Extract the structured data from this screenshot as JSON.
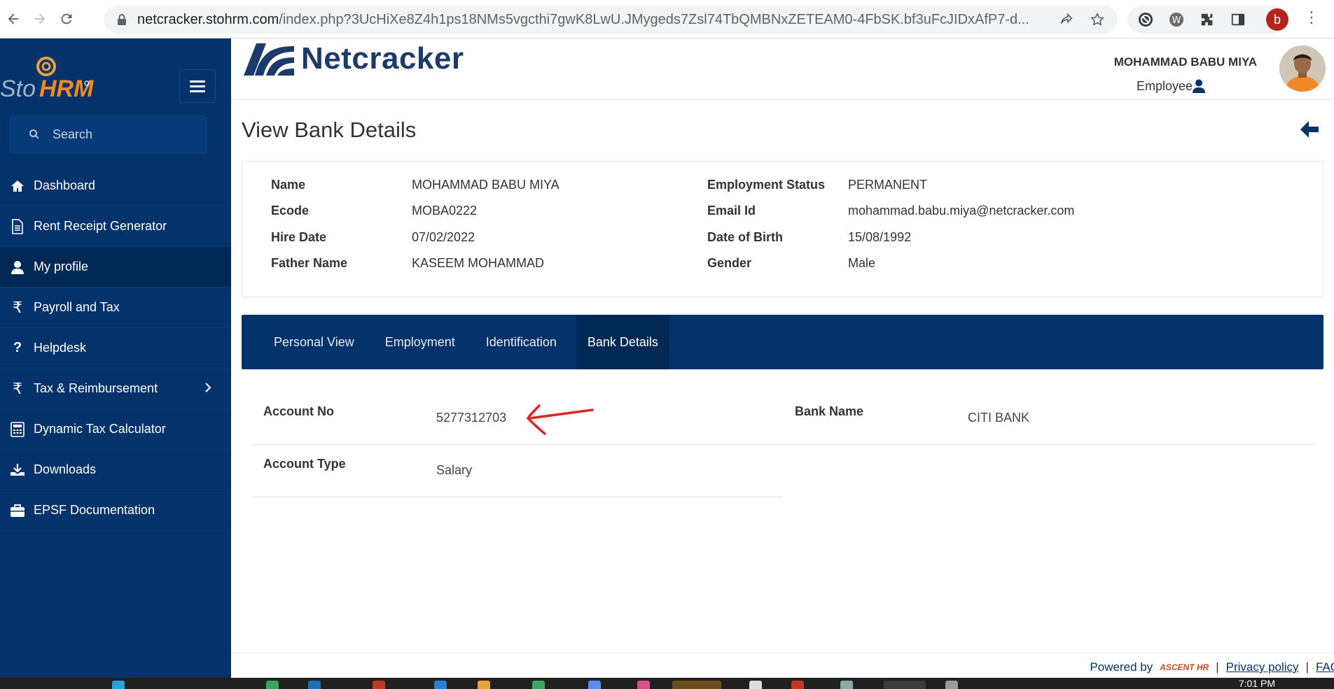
{
  "browser": {
    "url_host": "netcracker.stohrm.com",
    "url_path": "/index.php?3UcHiXe8Z4h1ps18NMs5vgcthi7gwK8LwU.JMygeds7Zsl74TbQMBNxZETEAM0-4FbSK.bf3uFcJIDxAfP7-d...",
    "profile_initial": "b"
  },
  "sidebar": {
    "logo_text": "StoHRM",
    "search_placeholder": "Search",
    "items": [
      {
        "label": "Dashboard",
        "icon": "home-icon"
      },
      {
        "label": "Rent Receipt Generator",
        "icon": "document-icon"
      },
      {
        "label": "My profile",
        "icon": "user-icon",
        "active": true
      },
      {
        "label": "Payroll and Tax",
        "icon": "rupee-icon"
      },
      {
        "label": "Helpdesk",
        "icon": "question-icon"
      },
      {
        "label": "Tax & Reimbursement",
        "icon": "rupee-icon",
        "has_submenu": true
      },
      {
        "label": "Dynamic Tax Calculator",
        "icon": "calculator-icon"
      },
      {
        "label": "Downloads",
        "icon": "download-icon"
      },
      {
        "label": "EPSF Documentation",
        "icon": "briefcase-icon"
      }
    ]
  },
  "header": {
    "company": "Netcracker",
    "user_name": "MOHAMMAD BABU MIYA",
    "user_role": "Employee"
  },
  "page": {
    "title": "View Bank Details"
  },
  "employee": {
    "name_label": "Name",
    "name": "MOHAMMAD BABU MIYA",
    "ecode_label": "Ecode",
    "ecode": "MOBA0222",
    "hire_date_label": "Hire Date",
    "hire_date": "07/02/2022",
    "father_label": "Father Name",
    "father": "KASEEM MOHAMMAD",
    "status_label": "Employment Status",
    "status": "PERMANENT",
    "email_label": "Email Id",
    "email": "mohammad.babu.miya@netcracker.com",
    "dob_label": "Date of Birth",
    "dob": "15/08/1992",
    "gender_label": "Gender",
    "gender": "Male"
  },
  "tabs": [
    {
      "label": "Personal View"
    },
    {
      "label": "Employment"
    },
    {
      "label": "Identification"
    },
    {
      "label": "Bank Details",
      "active": true
    }
  ],
  "bank": {
    "account_no_label": "Account No",
    "account_no": "5277312703",
    "bank_name_label": "Bank Name",
    "bank_name": "CITI BANK",
    "account_type_label": "Account Type",
    "account_type": "Salary"
  },
  "footer": {
    "powered_by": "Powered by",
    "brand": "ASCENT HR",
    "privacy": "Privacy policy",
    "faq": "FAQ",
    "sep": "|"
  },
  "taskbar": {
    "time": "7:01 PM"
  },
  "colors": {
    "sidebar_bg": "#04326b",
    "tab_bar_bg": "#04326b",
    "annotation_arrow": "#e02424"
  }
}
